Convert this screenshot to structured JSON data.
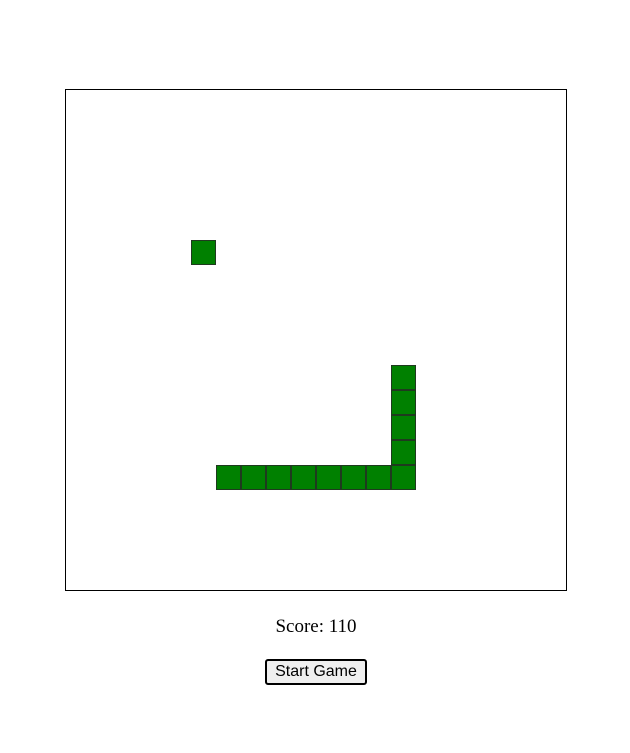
{
  "game": {
    "grid": {
      "columns": 20,
      "rows": 20
    },
    "food": {
      "col": 5,
      "row": 6
    },
    "snake": [
      {
        "col": 13,
        "row": 11
      },
      {
        "col": 13,
        "row": 12
      },
      {
        "col": 13,
        "row": 13
      },
      {
        "col": 13,
        "row": 14
      },
      {
        "col": 13,
        "row": 15
      },
      {
        "col": 12,
        "row": 15
      },
      {
        "col": 11,
        "row": 15
      },
      {
        "col": 10,
        "row": 15
      },
      {
        "col": 9,
        "row": 15
      },
      {
        "col": 8,
        "row": 15
      },
      {
        "col": 7,
        "row": 15
      },
      {
        "col": 6,
        "row": 15
      }
    ],
    "colors": {
      "snake": "#008000",
      "food": "#008000",
      "cell_border": "#1f3a1f"
    }
  },
  "score": {
    "label": "Score:",
    "value": 110,
    "text": "Score: 110"
  },
  "controls": {
    "start_label": "Start Game"
  }
}
